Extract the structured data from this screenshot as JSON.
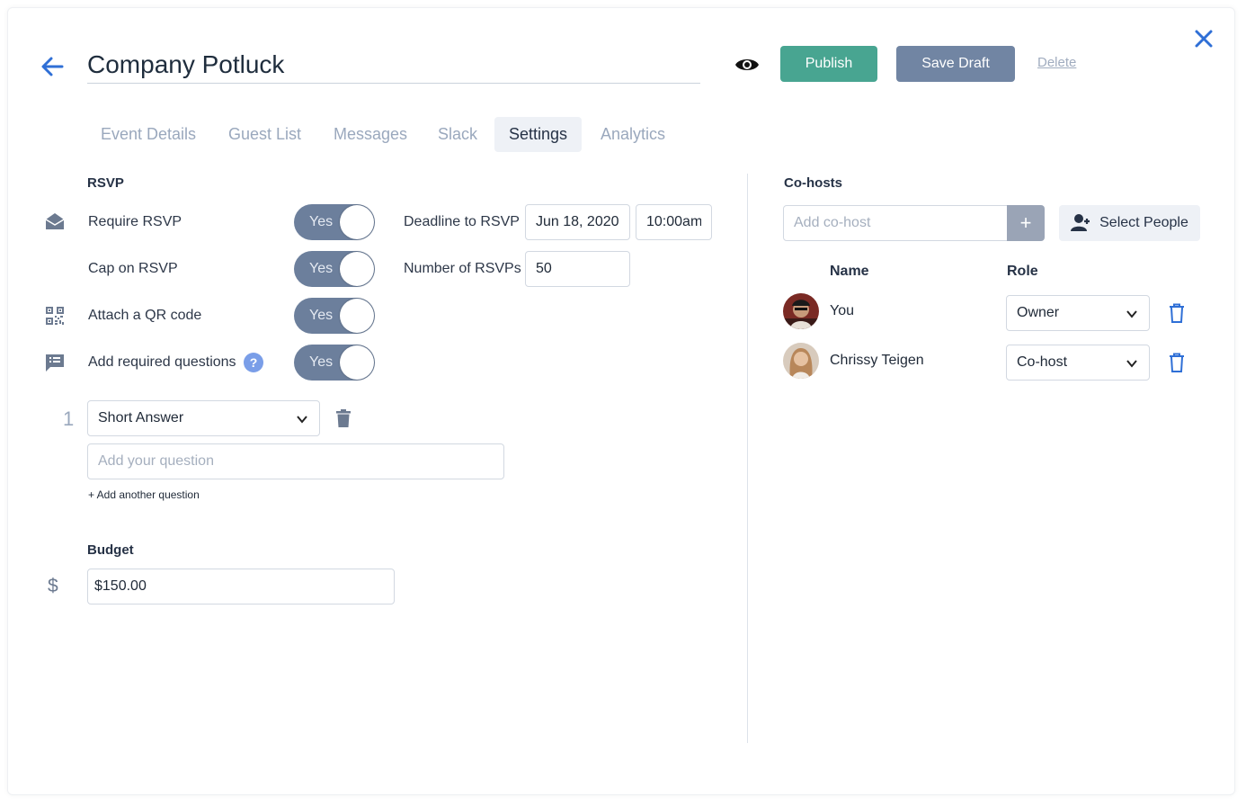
{
  "header": {
    "title": "Company Potluck",
    "publish_label": "Publish",
    "save_draft_label": "Save Draft",
    "delete_label": "Delete"
  },
  "tabs": [
    {
      "label": "Event Details",
      "active": false
    },
    {
      "label": "Guest List",
      "active": false
    },
    {
      "label": "Messages",
      "active": false
    },
    {
      "label": "Slack",
      "active": false
    },
    {
      "label": "Settings",
      "active": true
    },
    {
      "label": "Analytics",
      "active": false
    }
  ],
  "rsvp": {
    "section_label": "RSVP",
    "require_rsvp": {
      "label": "Require RSVP",
      "toggle": "Yes",
      "icon": "envelope-open-icon"
    },
    "cap_rsvp": {
      "label": "Cap on RSVP",
      "toggle": "Yes"
    },
    "qr_code": {
      "label": "Attach a QR code",
      "toggle": "Yes",
      "icon": "qr-code-icon"
    },
    "required_questions": {
      "label": "Add required questions",
      "toggle": "Yes",
      "icon": "message-list-icon",
      "help": "?"
    },
    "deadline_label": "Deadline to RSVP",
    "deadline_date": "Jun 18, 2020",
    "deadline_time": "10:00am",
    "number_label": "Number of RSVPs",
    "number_value": "50"
  },
  "questions": {
    "items": [
      {
        "number": "1",
        "type": "Short Answer",
        "placeholder": "Add your question"
      }
    ],
    "add_another_label": "+ Add another question"
  },
  "budget": {
    "section_label": "Budget",
    "currency_symbol": "$",
    "value": "$150.00"
  },
  "cohosts": {
    "section_label": "Co-hosts",
    "add_placeholder": "Add co-host",
    "add_button": "+",
    "select_people_label": "Select People",
    "col_name": "Name",
    "col_role": "Role",
    "people": [
      {
        "name": "You",
        "role": "Owner"
      },
      {
        "name": "Chrissy Teigen",
        "role": "Co-host"
      }
    ]
  },
  "colors": {
    "accent_blue": "#2f6fd6",
    "publish_green": "#48a591",
    "draft_slate": "#7185a3",
    "toggle_on": "#6c7f9c"
  }
}
